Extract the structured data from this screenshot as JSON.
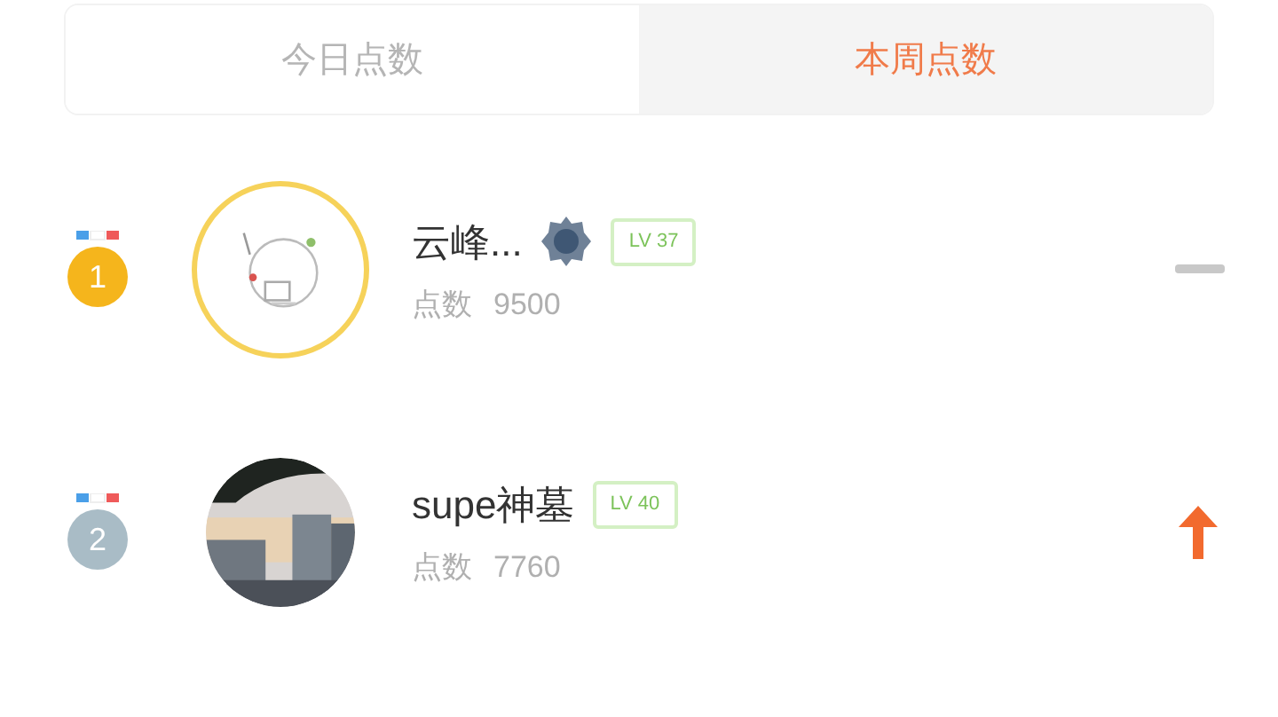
{
  "tabs": [
    {
      "label": "今日点数",
      "selected": false
    },
    {
      "label": "本周点数",
      "selected": true
    }
  ],
  "ranking": [
    {
      "rank": "1",
      "color": "#f5b51c",
      "highlighted": true,
      "name": "云峰...",
      "badge": true,
      "level": "LV 37",
      "points_label": "点数",
      "points": "9500",
      "kind": "same"
    },
    {
      "rank": "2",
      "color": "#a9bcc6",
      "highlighted": false,
      "name": "supe神墓",
      "badge": false,
      "level": "LV 40",
      "points_label": "点数",
      "points": "7760",
      "kind": "up"
    }
  ]
}
